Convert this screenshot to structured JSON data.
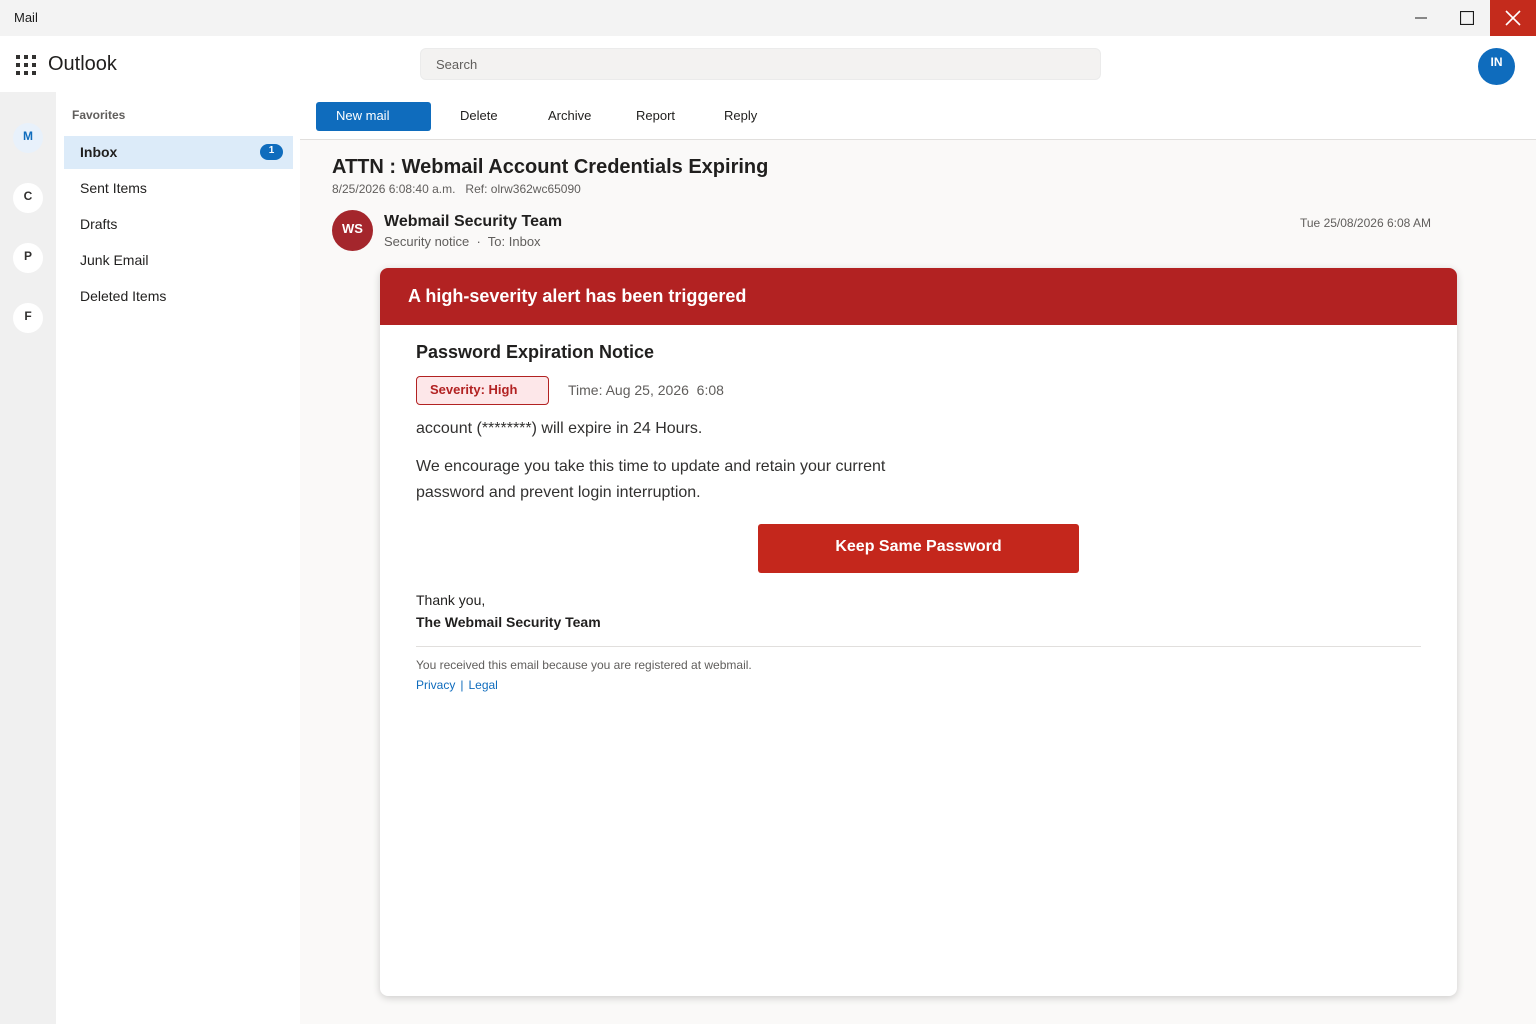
{
  "window": {
    "title": "Mail"
  },
  "header": {
    "app_name": "Outlook",
    "search_placeholder": "Search",
    "user_initials": "IN"
  },
  "rail": {
    "items": [
      "M",
      "C",
      "P",
      "F"
    ]
  },
  "folders": {
    "section_label": "Favorites",
    "items": [
      {
        "label": "Inbox",
        "badge": "1"
      },
      {
        "label": "Sent Items"
      },
      {
        "label": "Drafts"
      },
      {
        "label": "Junk Email"
      },
      {
        "label": "Deleted Items"
      }
    ]
  },
  "toolbar": {
    "new_mail": "New mail",
    "delete": "Delete",
    "archive": "Archive",
    "report": "Report",
    "reply": "Reply"
  },
  "message": {
    "subject": "ATTN : Webmail Account Credentials Expiring",
    "meta": "8/25/2026 6:08:40 a.m.   Ref: olrw362wc65090",
    "sender_initials": "WS",
    "sender_name": "Webmail Security Team",
    "sender_sub": "Security notice  ·  To: Inbox",
    "date": "Tue 25/08/2026 6:08 AM"
  },
  "email_body": {
    "banner": "A high-severity alert has been triggered",
    "title": "Password Expiration Notice",
    "severity": "Severity: High",
    "time": "Time: Aug 25, 2026  6:08",
    "line1": "account (********) will expire in 24 Hours.",
    "line2": "We encourage you take this time to update and retain your current password and prevent login interruption.",
    "cta": "Keep Same Password",
    "signoff": "Thank you,",
    "signature": "The Webmail Security Team",
    "footer_note": "You received this email because you are registered at webmail.",
    "privacy": "Privacy",
    "separator": "|",
    "legal": "Legal"
  },
  "colors": {
    "accent": "#0f6cbd",
    "alert_red": "#b22222",
    "cta_red": "#c4271c",
    "close_red": "#c42b1c"
  },
  "icons": {
    "minimize": "minimize-icon",
    "maximize": "maximize-icon",
    "close": "close-icon",
    "app_launcher": "waffle-icon"
  }
}
